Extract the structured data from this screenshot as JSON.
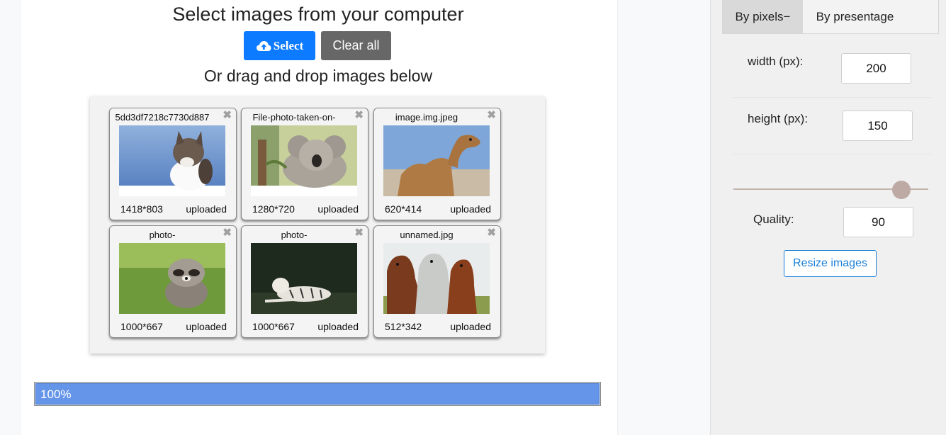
{
  "header": {
    "title": "Select images from your computer",
    "select_label": "Select",
    "clear_label": "Clear all",
    "subtitle": "Or drag and drop images below"
  },
  "images": [
    {
      "name": "5dd3df7218c7730d887",
      "dims": "1418*803",
      "status": "uploaded",
      "thumb": "cat"
    },
    {
      "name": "File-photo-taken-on-",
      "dims": "1280*720",
      "status": "uploaded",
      "thumb": "koala"
    },
    {
      "name": "image.img.jpeg",
      "dims": "620*414",
      "status": "uploaded",
      "thumb": "camel"
    },
    {
      "name": "photo-",
      "dims": "1000*667",
      "status": "uploaded",
      "thumb": "raccoon"
    },
    {
      "name": "photo-",
      "dims": "1000*667",
      "status": "uploaded",
      "thumb": "tiger"
    },
    {
      "name": "unnamed.jpg",
      "dims": "512*342",
      "status": "uploaded",
      "thumb": "horses"
    }
  ],
  "progress": {
    "label": "100%",
    "value": 1.0
  },
  "settings": {
    "tabs": {
      "pixels": "By pixels−",
      "percentage": "By presentage"
    },
    "width_label": "width (px):",
    "width_value": "200",
    "height_label": "height (px):",
    "height_value": "150",
    "quality_label": "Quality:",
    "quality_value": "90",
    "slider_value": 0.9,
    "resize_label": "Resize images"
  },
  "colors": {
    "primary": "#0d7bff",
    "secondary": "#676767",
    "progress": "#6595e8",
    "outline": "#1c80d8"
  },
  "icons": {
    "select": "cloud-upload-icon",
    "close": "close-icon"
  }
}
